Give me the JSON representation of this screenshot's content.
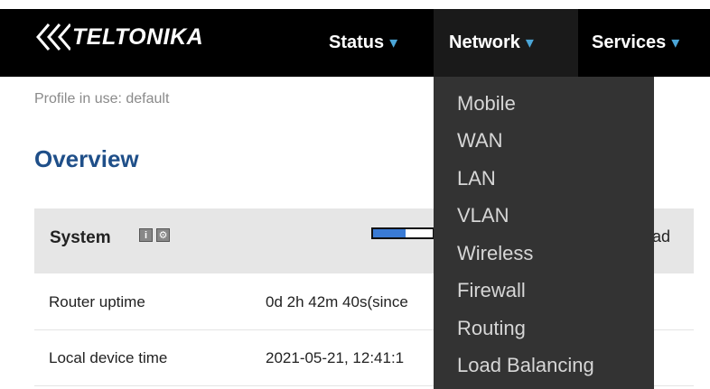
{
  "brand": {
    "logo_text": "TELTONIKA"
  },
  "nav": {
    "status": "Status",
    "network": "Network",
    "services": "Services",
    "chevron": "▾"
  },
  "dropdown": {
    "items": [
      "Mobile",
      "WAN",
      "LAN",
      "VLAN",
      "Wireless",
      "Firewall",
      "Routing",
      "Load Balancing"
    ]
  },
  "profile": "Profile in use: default",
  "page_title": "Overview",
  "system_panel": {
    "title": "System",
    "load_text": "ad",
    "load_fraction": 0.55,
    "rows": [
      {
        "label": "Router uptime",
        "value": "0d 2h 42m 40s(since"
      },
      {
        "label": "Local device time",
        "value": "2021-05-21, 12:41:1"
      }
    ]
  },
  "colors": {
    "topbar": "#000000",
    "dropdown": "#333333",
    "accent": "#4ba6d8",
    "title": "#1f4f89",
    "bar_fill": "#3a7bd5"
  },
  "icons": [
    "teltonika-logo-icon",
    "chevron-down-icon",
    "info-icon",
    "gear-icon"
  ]
}
